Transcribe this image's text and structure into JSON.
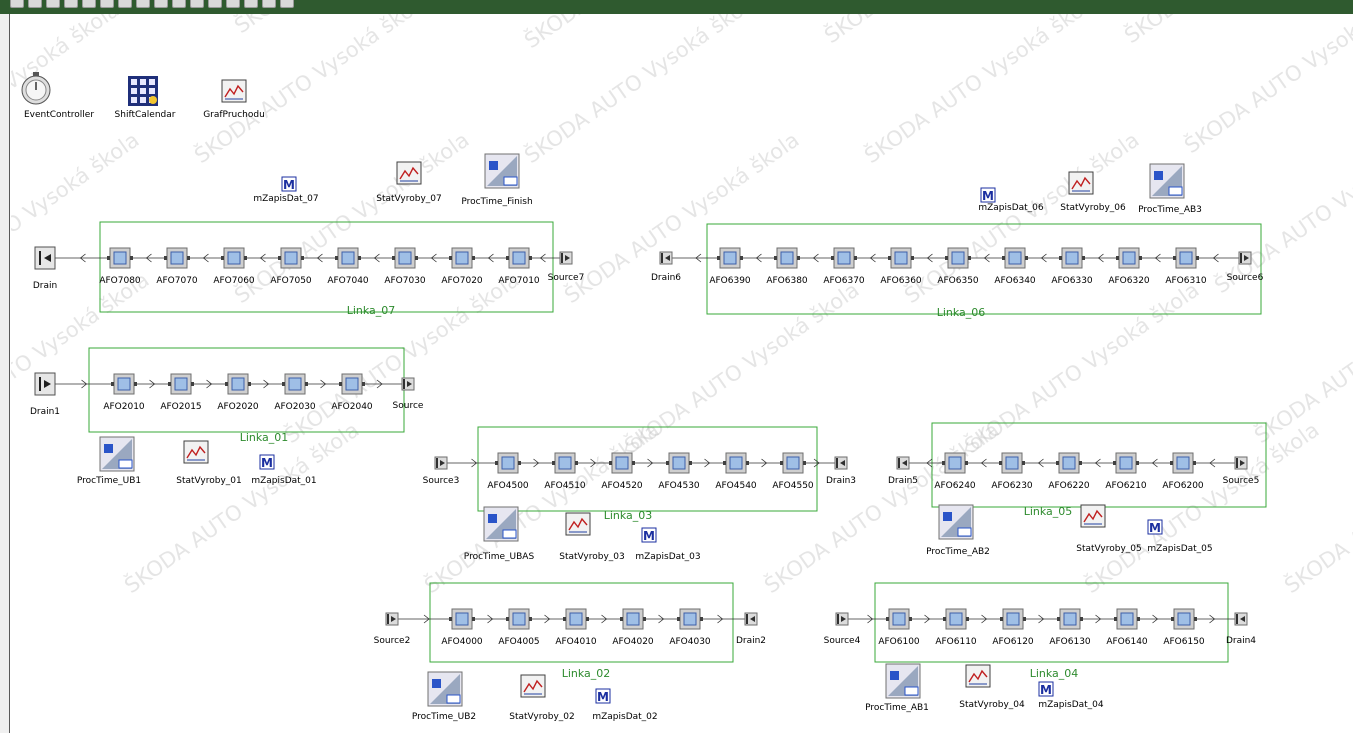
{
  "toolbar": {
    "icons": [
      "layout-icon",
      "zoom-icon",
      "grid-icon",
      "clock-icon",
      "flow-icon",
      "play-icon",
      "step-icon",
      "stop-icon",
      "reset-icon",
      "zoom-in-icon",
      "zoom-out-icon",
      "tools-icon",
      "chart-icon",
      "arrow-icon",
      "select-icon",
      "help-icon"
    ]
  },
  "watermark": [
    "ŠKODA AUTO Vysoká škola"
  ],
  "objects": {
    "event_controller": "EventController",
    "shift_calendar": "ShiftCalendar",
    "graf_pruchodu": "GrafPruchodu"
  },
  "lines": [
    {
      "id": "linka_07",
      "title": "Linka_07",
      "source": "Source7",
      "drain": "Drain",
      "direction": "rtl",
      "stations": [
        "AFO7080",
        "AFO7070",
        "AFO7060",
        "AFO7050",
        "AFO7040",
        "AFO7030",
        "AFO7020",
        "AFO7010"
      ],
      "tools": [
        "mZapisDat_07",
        "StatVyroby_07",
        "ProcTime_Finish"
      ]
    },
    {
      "id": "linka_06",
      "title": "Linka_06",
      "source": "Source6",
      "drain": "Drain6",
      "direction": "rtl",
      "stations": [
        "AFO6390",
        "AFO6380",
        "AFO6370",
        "AFO6360",
        "AFO6350",
        "AFO6340",
        "AFO6330",
        "AFO6320",
        "AFO6310"
      ],
      "tools": [
        "mZapisDat_06",
        "StatVyroby_06",
        "ProcTime_AB3"
      ]
    },
    {
      "id": "linka_01",
      "title": "Linka_01",
      "source": "Source",
      "drain": "Drain1",
      "direction": "ltr",
      "stations": [
        "AFO2010",
        "AFO2015",
        "AFO2020",
        "AFO2030",
        "AFO2040"
      ],
      "tools": [
        "ProcTime_UB1",
        "StatVyroby_01",
        "mZapisDat_01"
      ]
    },
    {
      "id": "linka_03",
      "title": "Linka_03",
      "source": "Source3",
      "drain": "Drain3",
      "direction": "ltr",
      "stations": [
        "AFO4500",
        "AFO4510",
        "AFO4520",
        "AFO4530",
        "AFO4540",
        "AFO4550"
      ],
      "tools": [
        "ProcTime_UBAS",
        "StatVyroby_03",
        "mZapisDat_03"
      ]
    },
    {
      "id": "linka_05",
      "title": "Linka_05",
      "source": "Source5",
      "drain": "Drain5",
      "direction": "rtl",
      "stations": [
        "AFO6240",
        "AFO6230",
        "AFO6220",
        "AFO6210",
        "AFO6200"
      ],
      "tools": [
        "ProcTime_AB2",
        "StatVyroby_05",
        "mZapisDat_05"
      ]
    },
    {
      "id": "linka_02",
      "title": "Linka_02",
      "source": "Source2",
      "drain": "Drain2",
      "direction": "ltr",
      "stations": [
        "AFO4000",
        "AFO4005",
        "AFO4010",
        "AFO4020",
        "AFO4030"
      ],
      "tools": [
        "ProcTime_UB2",
        "StatVyroby_02",
        "mZapisDat_02"
      ]
    },
    {
      "id": "linka_04",
      "title": "Linka_04",
      "source": "Source4",
      "drain": "Drain4",
      "direction": "ltr",
      "stations": [
        "AFO6100",
        "AFO6110",
        "AFO6120",
        "AFO6130",
        "AFO6140",
        "AFO6150"
      ],
      "tools": [
        "ProcTime_AB1",
        "StatVyroby_04",
        "mZapisDat_04"
      ]
    }
  ]
}
